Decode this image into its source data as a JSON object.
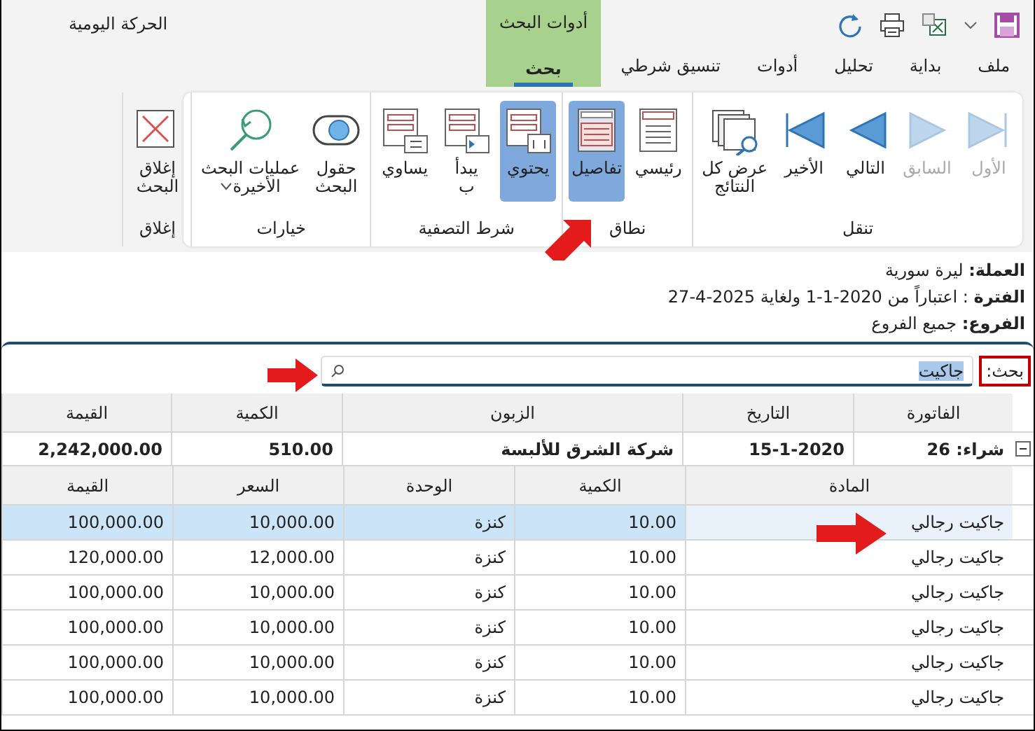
{
  "window": {
    "title": "الحركة اليومية"
  },
  "tabs": [
    {
      "label": "ملف",
      "selected": false
    },
    {
      "label": "بداية",
      "selected": false
    },
    {
      "label": "تحليل",
      "selected": false
    },
    {
      "label": "أدوات",
      "selected": false
    },
    {
      "label": "تنسيق شرطي",
      "selected": false
    }
  ],
  "context_tabs": {
    "title": "أدوات البحث",
    "tabs": [
      {
        "label": "بحث",
        "selected": true
      }
    ]
  },
  "ribbon": {
    "groups": [
      {
        "label": "تنقل",
        "buttons": [
          {
            "kind": "first",
            "label": "الأول",
            "disabled": true
          },
          {
            "kind": "previous",
            "label": "السابق",
            "disabled": true
          },
          {
            "kind": "next",
            "label": "التالي",
            "disabled": false
          },
          {
            "kind": "last",
            "label": "الأخير",
            "disabled": false
          },
          {
            "kind": "show-all",
            "label": "عرض كل\nالنتائج",
            "disabled": false
          }
        ]
      },
      {
        "label": "نطاق",
        "buttons": [
          {
            "kind": "master",
            "label": "رئيسي",
            "selected": false
          },
          {
            "kind": "details",
            "label": "تفاصيل",
            "selected": true
          }
        ]
      },
      {
        "label": "شرط التصفية",
        "buttons": [
          {
            "kind": "contains",
            "label": "يحتوي",
            "selected": true
          },
          {
            "kind": "starts-with",
            "label": "يبدأ\nب",
            "selected": false
          },
          {
            "kind": "equals",
            "label": "يساوي",
            "selected": false
          }
        ]
      },
      {
        "label": "خيارات",
        "buttons": [
          {
            "kind": "fields",
            "label": "حقول\nالبحث"
          },
          {
            "kind": "recent",
            "label": "عمليات البحث\nالأخيرة"
          }
        ]
      },
      {
        "label": "إغلاق",
        "buttons": [
          {
            "kind": "close",
            "label": "إغلاق\nالبحث"
          }
        ]
      }
    ]
  },
  "info": [
    "**العملة:** ليرة سورية",
    "**الفترة** : اعتباراً من 2020-1-1 ولغاية 2025-4-27",
    "**الفروع:** جميع الفروع"
  ],
  "search": {
    "label": "بحث:",
    "value": "جاكيت"
  },
  "table": {
    "columns": [
      "الفاتورة",
      "التاريخ",
      "الزبون",
      "الكمية",
      "القيمة"
    ],
    "group_row": {
      "expanded": true,
      "cells": [
        "شراء: 26",
        "15-1-2020",
        "شركة الشرق للألبسة",
        "510.00",
        "2,242,000.00"
      ]
    },
    "detail_columns": [
      "المادة",
      "الكمية",
      "الوحدة",
      "السعر",
      "القيمة"
    ],
    "rows": [
      {
        "selected": true,
        "cells": [
          "جاكيت رجالي",
          "10.00",
          "كنزة",
          "10,000.00",
          "100,000.00"
        ]
      },
      {
        "selected": false,
        "cells": [
          "جاكيت رجالي",
          "10.00",
          "كنزة",
          "12,000.00",
          "120,000.00"
        ]
      },
      {
        "selected": false,
        "cells": [
          "جاكيت رجالي",
          "10.00",
          "كنزة",
          "10,000.00",
          "100,000.00"
        ]
      },
      {
        "selected": false,
        "cells": [
          "جاكيت رجالي",
          "10.00",
          "كنزة",
          "10,000.00",
          "100,000.00"
        ]
      },
      {
        "selected": false,
        "cells": [
          "جاكيت رجالي",
          "10.00",
          "كنزة",
          "10,000.00",
          "100,000.00"
        ]
      },
      {
        "selected": false,
        "cells": [
          "جاكيت رجالي",
          "10.00",
          "كنزة",
          "10,000.00",
          "100,000.00"
        ]
      }
    ]
  }
}
